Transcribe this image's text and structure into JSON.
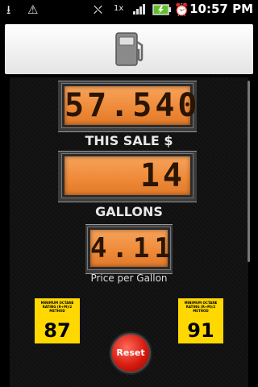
{
  "status_bar": {
    "time": "10:57 PM",
    "icons": [
      "usb-icon",
      "warning-icon",
      "no-signal-icon",
      "data-1x-icon",
      "signal-bars-icon",
      "battery-charging-icon",
      "alarm-icon"
    ]
  },
  "header": {
    "icon": "fuel-pump-icon"
  },
  "displays": {
    "total": "57.540",
    "sale_label": "THIS SALE $",
    "gallons": "14",
    "gallons_label": "GALLONS",
    "price": "4.11",
    "price_label": "Price per Gallon"
  },
  "octane": [
    {
      "small": "MINIMUM OCTANE RATING (R+M)/2 METHOD",
      "value": "87"
    },
    {
      "small": "MINIMUM OCTANE RATING (R+M)/2 METHOD",
      "value": "91"
    }
  ],
  "reset_label": "Reset",
  "colors": {
    "lcd": "#ee8938",
    "octane": "#ffd800",
    "reset": "#d81b10"
  }
}
